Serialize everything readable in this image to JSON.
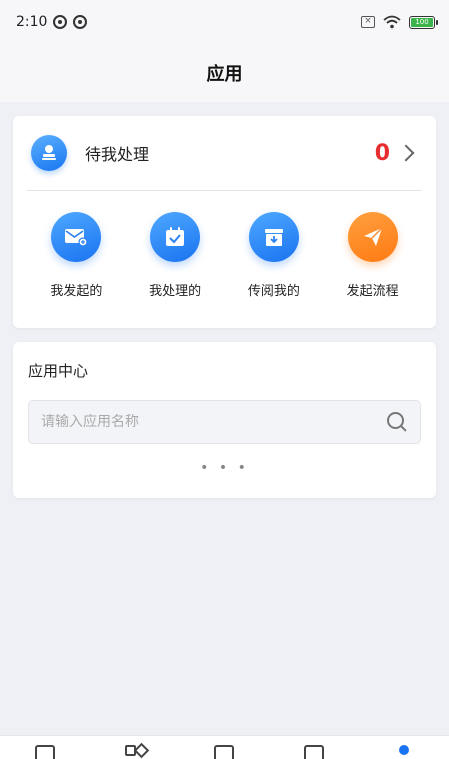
{
  "status_bar": {
    "time": "2:10",
    "battery_label": "100"
  },
  "header": {
    "title": "应用"
  },
  "pending": {
    "label": "待我处理",
    "count": "0"
  },
  "actions": [
    {
      "label": "我发起的",
      "icon": "mail-send-icon",
      "color": "#1a73f0"
    },
    {
      "label": "我处理的",
      "icon": "calendar-check-icon",
      "color": "#1a73f0"
    },
    {
      "label": "传阅我的",
      "icon": "archive-download-icon",
      "color": "#1a73f0"
    },
    {
      "label": "发起流程",
      "icon": "paper-plane-icon",
      "color": "#ff7a12"
    }
  ],
  "app_center": {
    "title": "应用中心",
    "search_placeholder": "请输入应用名称",
    "loading": "• • •"
  },
  "tabbar": {
    "icons": [
      "document-icon",
      "apps-grid-icon",
      "briefcase-icon",
      "contacts-icon",
      "profile-dot-icon"
    ],
    "active_color": "#1a73f0"
  }
}
